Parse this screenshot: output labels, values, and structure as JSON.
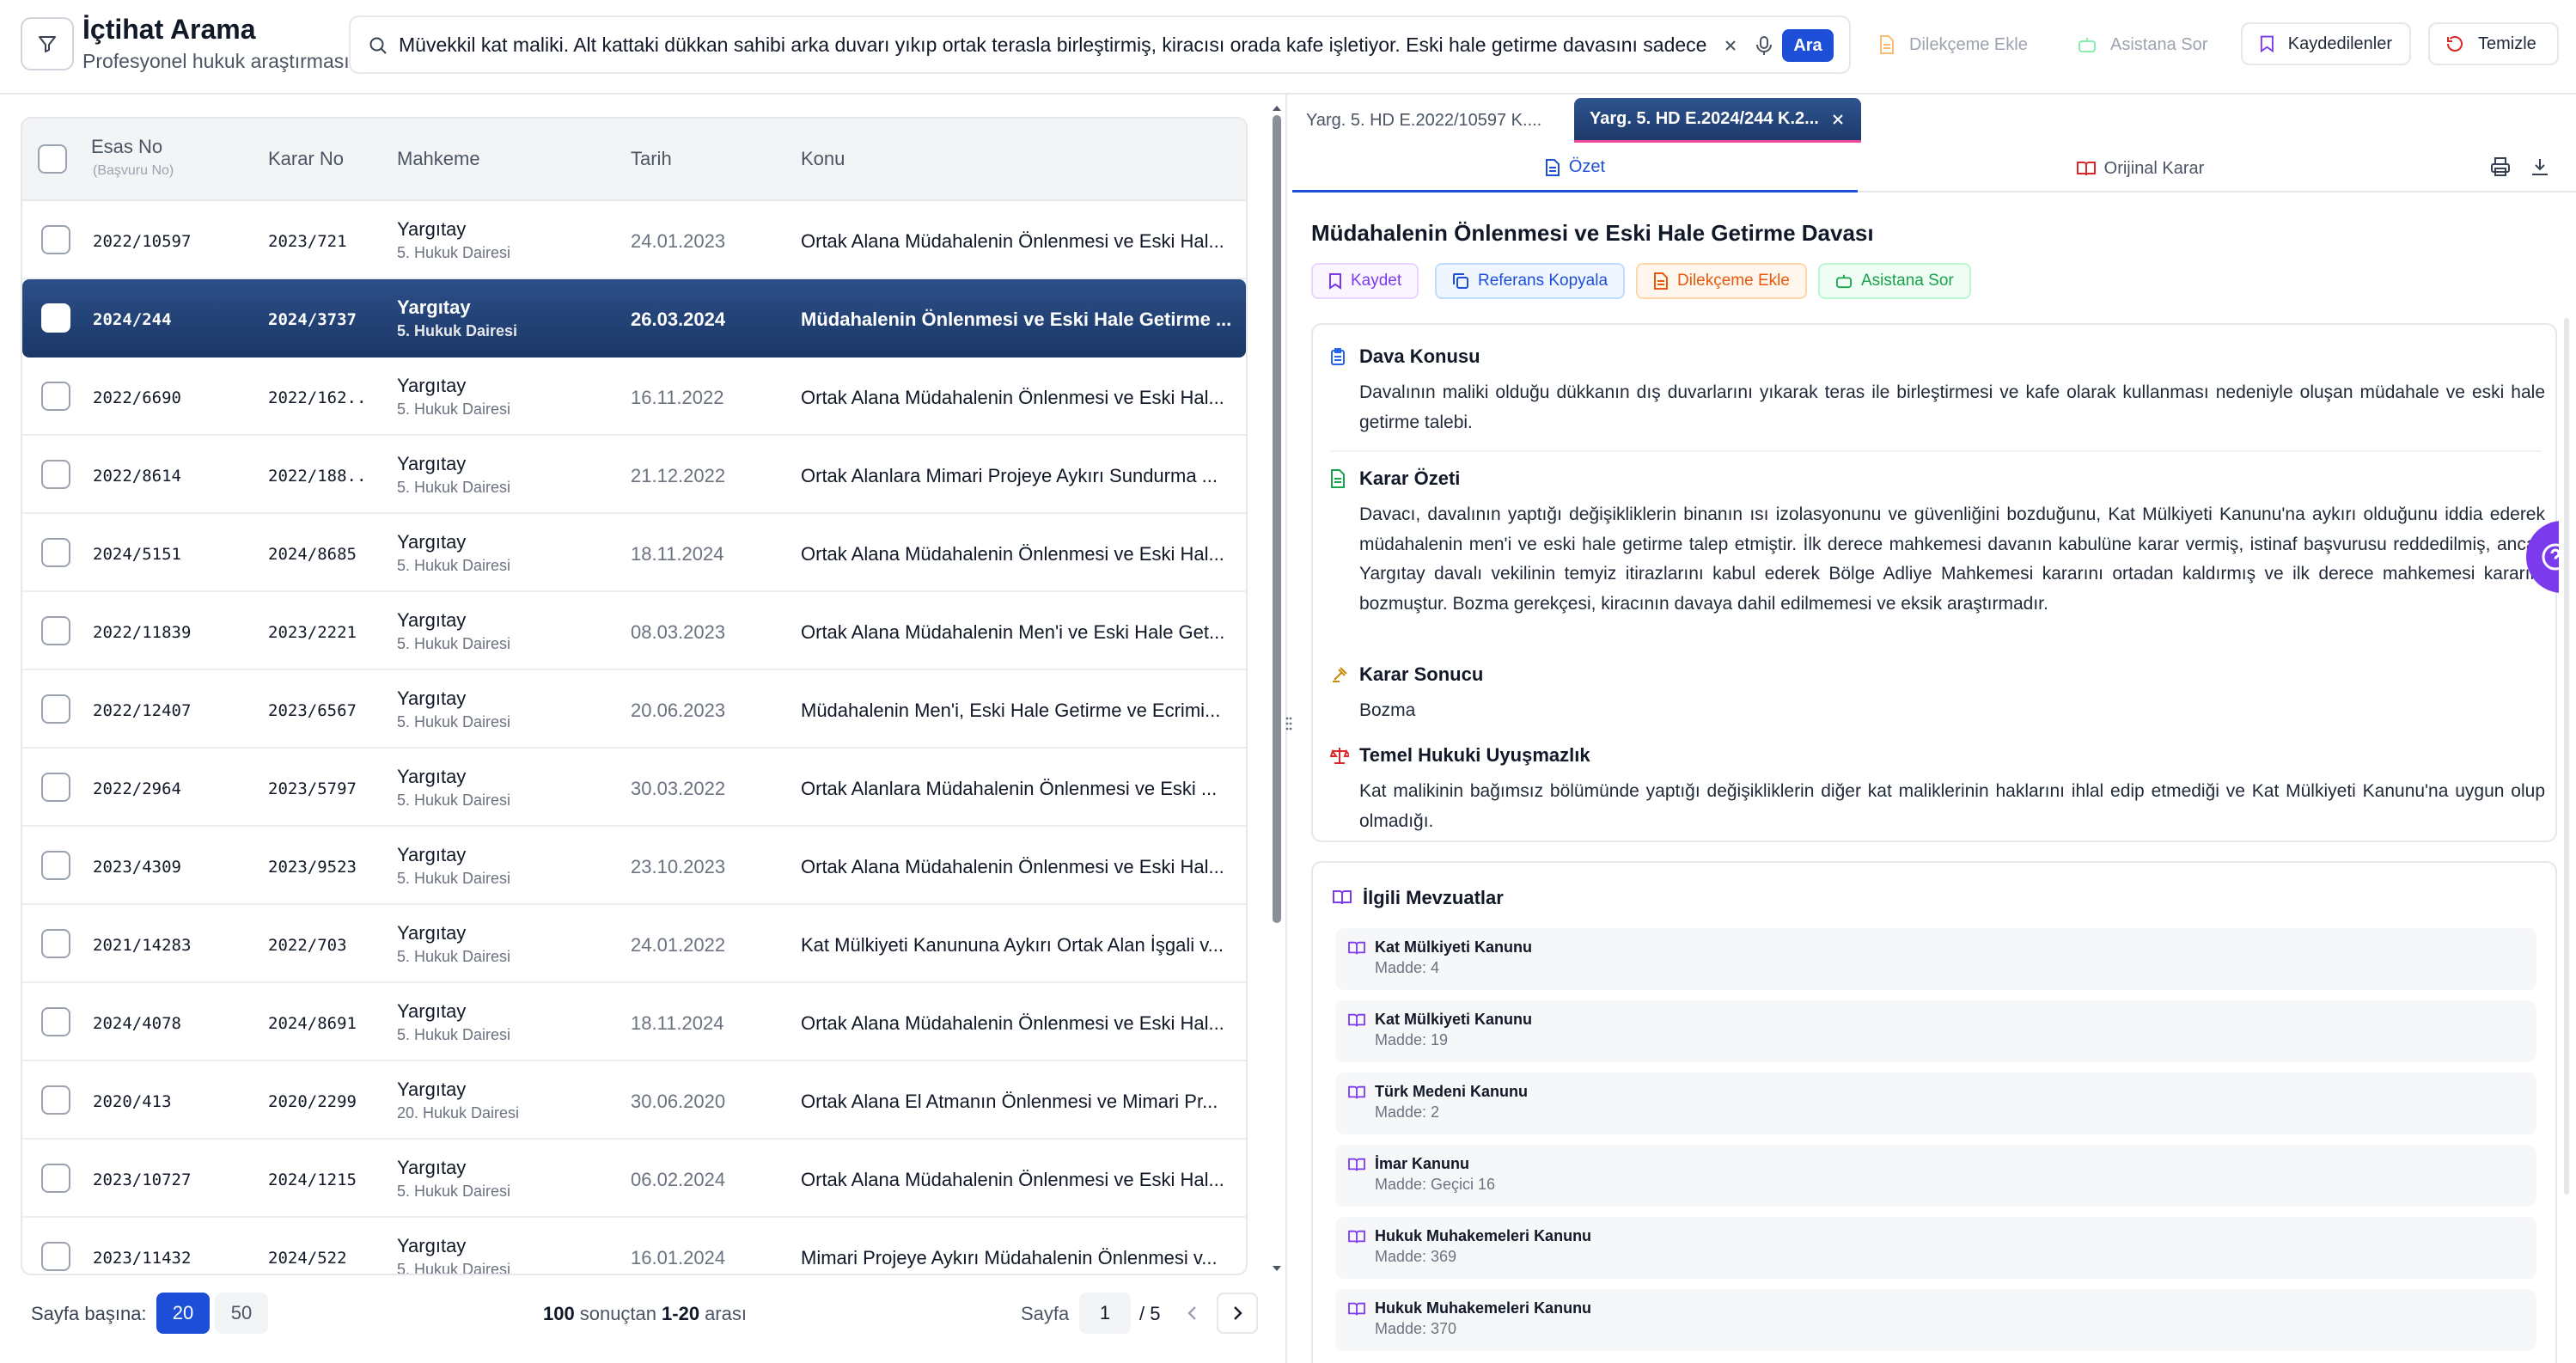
{
  "header": {
    "title": "İçtihat Arama",
    "subtitle": "Profesyonel hukuk araştırması",
    "search_value": "Müvekkil kat maliki. Alt kattaki dükkan sahibi arka duvarı yıkıp ortak terasla birleştirmiş, kiracısı orada kafe işletiyor. Eski hale getirme davasını sadece mali",
    "search_button": "Ara",
    "dilekceme_ekle": "Dilekçeme Ekle",
    "asistana_sor": "Asistana Sor",
    "kaydedilenler": "Kaydedilenler",
    "temizle": "Temizle"
  },
  "table": {
    "columns": {
      "esas": "Esas No",
      "esas_sub": "(Başvuru No)",
      "karar": "Karar No",
      "mahkeme": "Mahkeme",
      "tarih": "Tarih",
      "konu": "Konu"
    },
    "rows": [
      {
        "esas": "2022/10597",
        "karar": "2023/721",
        "court": "Yargıtay",
        "daire": "5. Hukuk Dairesi",
        "date": "24.01.2023",
        "konu": "Ortak Alana Müdahalenin Önlenmesi ve Eski Hal..."
      },
      {
        "esas": "2024/244",
        "karar": "2024/3737",
        "court": "Yargıtay",
        "daire": "5. Hukuk Dairesi",
        "date": "26.03.2024",
        "konu": "Müdahalenin Önlenmesi ve Eski Hale Getirme ..."
      },
      {
        "esas": "2022/6690",
        "karar": "2022/162...",
        "court": "Yargıtay",
        "daire": "5. Hukuk Dairesi",
        "date": "16.11.2022",
        "konu": "Ortak Alana Müdahalenin Önlenmesi ve Eski Hal..."
      },
      {
        "esas": "2022/8614",
        "karar": "2022/188...",
        "court": "Yargıtay",
        "daire": "5. Hukuk Dairesi",
        "date": "21.12.2022",
        "konu": "Ortak Alanlara Mimari Projeye Aykırı Sundurma ..."
      },
      {
        "esas": "2024/5151",
        "karar": "2024/8685",
        "court": "Yargıtay",
        "daire": "5. Hukuk Dairesi",
        "date": "18.11.2024",
        "konu": "Ortak Alana Müdahalenin Önlenmesi ve Eski Hal..."
      },
      {
        "esas": "2022/11839",
        "karar": "2023/2221",
        "court": "Yargıtay",
        "daire": "5. Hukuk Dairesi",
        "date": "08.03.2023",
        "konu": "Ortak Alana Müdahalenin Men'i ve Eski Hale Get..."
      },
      {
        "esas": "2022/12407",
        "karar": "2023/6567",
        "court": "Yargıtay",
        "daire": "5. Hukuk Dairesi",
        "date": "20.06.2023",
        "konu": "Müdahalenin Men'i, Eski Hale Getirme ve Ecrimi..."
      },
      {
        "esas": "2022/2964",
        "karar": "2023/5797",
        "court": "Yargıtay",
        "daire": "5. Hukuk Dairesi",
        "date": "30.03.2022",
        "konu": "Ortak Alanlara Müdahalenin Önlenmesi ve Eski ..."
      },
      {
        "esas": "2023/4309",
        "karar": "2023/9523",
        "court": "Yargıtay",
        "daire": "5. Hukuk Dairesi",
        "date": "23.10.2023",
        "konu": "Ortak Alana Müdahalenin Önlenmesi ve Eski Hal..."
      },
      {
        "esas": "2021/14283",
        "karar": "2022/703",
        "court": "Yargıtay",
        "daire": "5. Hukuk Dairesi",
        "date": "24.01.2022",
        "konu": "Kat Mülkiyeti Kanununa Aykırı Ortak Alan İşgali v..."
      },
      {
        "esas": "2024/4078",
        "karar": "2024/8691",
        "court": "Yargıtay",
        "daire": "5. Hukuk Dairesi",
        "date": "18.11.2024",
        "konu": "Ortak Alana Müdahalenin Önlenmesi ve Eski Hal..."
      },
      {
        "esas": "2020/413",
        "karar": "2020/2299",
        "court": "Yargıtay",
        "daire": "20. Hukuk Dairesi",
        "date": "30.06.2020",
        "konu": "Ortak Alana El Atmanın Önlenmesi ve Mimari Pr..."
      },
      {
        "esas": "2023/10727",
        "karar": "2024/1215",
        "court": "Yargıtay",
        "daire": "5. Hukuk Dairesi",
        "date": "06.02.2024",
        "konu": "Ortak Alana Müdahalenin Önlenmesi ve Eski Hal..."
      },
      {
        "esas": "2023/11432",
        "karar": "2024/522",
        "court": "Yargıtay",
        "daire": "5. Hukuk Dairesi",
        "date": "16.01.2024",
        "konu": "Mimari Projeye Aykırı Müdahalenin Önlenmesi v..."
      }
    ]
  },
  "footer": {
    "per_page_label": "Sayfa başına:",
    "per_page_20": "20",
    "per_page_50": "50",
    "total": "100",
    "total_suffix": "sonuçtan",
    "range": "1-20",
    "range_suffix": "arası",
    "page_label": "Sayfa",
    "page_current": "1",
    "page_total": "/ 5"
  },
  "detail": {
    "tabs": [
      {
        "label": "Yarg. 5. HD E.2022/10597 K...."
      },
      {
        "label": "Yarg. 5. HD E.2024/244 K.2..."
      }
    ],
    "subtabs": {
      "ozet": "Özet",
      "orijinal": "Orijinal Karar"
    },
    "title": "Müdahalenin Önlenmesi ve Eski Hale Getirme Davası",
    "actions": {
      "kaydet": "Kaydet",
      "referans": "Referans Kopyala",
      "dilekceme": "Dilekçeme Ekle",
      "asistan": "Asistana Sor"
    },
    "sections": {
      "dava_konusu_title": "Dava Konusu",
      "dava_konusu": "Davalının maliki olduğu dükkanın dış duvarlarını yıkarak teras ile birleştirmesi ve kafe olarak kullanması nedeniyle oluşan müdahale ve eski hale getirme talebi.",
      "karar_ozeti_title": "Karar Özeti",
      "karar_ozeti": "Davacı, davalının yaptığı değişikliklerin binanın ısı izolasyonunu ve güvenliğini bozduğunu, Kat Mülkiyeti Kanunu'na aykırı olduğunu iddia ederek müdahalenin men'i ve eski hale getirme talep etmiştir. İlk derece mahkemesi davanın kabulüne karar vermiş, istinaf başvurusu reddedilmiş, ancak Yargıtay davalı vekilinin temyiz itirazlarını kabul ederek Bölge Adliye Mahkemesi kararını ortadan kaldırmış ve ilk derece mahkemesi kararını bozmuştur. Bozma gerekçesi, kiracının davaya dahil edilmemesi ve eksik araştırmadır.",
      "karar_sonucu_title": "Karar Sonucu",
      "karar_sonucu": "Bozma",
      "uyusmazlik_title": "Temel Hukuki Uyuşmazlık",
      "uyusmazlik": "Kat malikinin bağımsız bölümünde yaptığı değişikliklerin diğer kat maliklerinin haklarını ihlal edip etmediği ve Kat Mülkiyeti Kanunu'na uygun olup olmadığı."
    },
    "mevzuat_title": "İlgili Mevzuatlar",
    "mevzuat": [
      {
        "name": "Kat Mülkiyeti Kanunu",
        "madde": "Madde: 4"
      },
      {
        "name": "Kat Mülkiyeti Kanunu",
        "madde": "Madde: 19"
      },
      {
        "name": "Türk Medeni Kanunu",
        "madde": "Madde: 2"
      },
      {
        "name": "İmar Kanunu",
        "madde": "Madde: Geçici 16"
      },
      {
        "name": "Hukuk Muhakemeleri Kanunu",
        "madde": "Madde: 369"
      },
      {
        "name": "Hukuk Muhakemeleri Kanunu",
        "madde": "Madde: 370"
      }
    ]
  },
  "colors": {
    "primary": "#1d4ed8",
    "selected_row": "#1f3b6e",
    "tab_active": "#2c4f88",
    "purple": "#7c3aed",
    "orange": "#ea580c",
    "green": "#16a34a",
    "red": "#dc2626"
  }
}
